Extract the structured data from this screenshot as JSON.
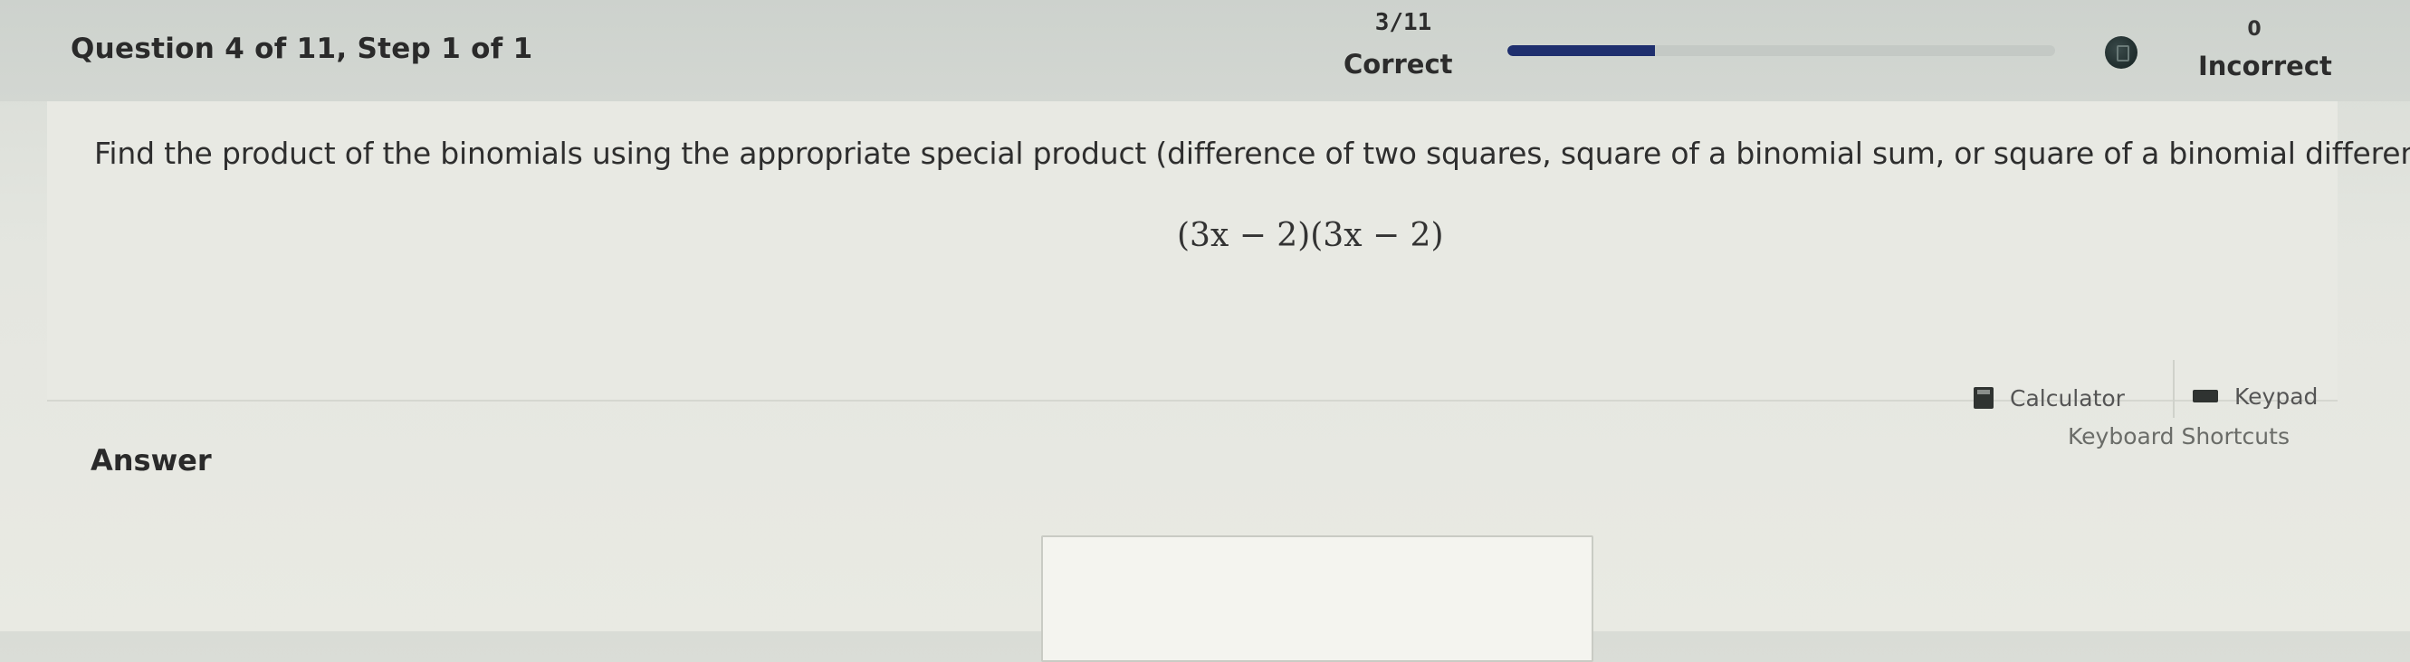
{
  "header": {
    "question_label": "Question 4 of 11,  Step 1 of 1",
    "correct_count": "3/11",
    "correct_label": "Correct",
    "incorrect_count": "0",
    "incorrect_label": "Incorrect",
    "progress_fraction": 0.27
  },
  "question": {
    "prompt": "Find the product of the binomials using the appropriate special product (difference of two squares, square of a binomial sum, or square of a binomial difference).",
    "expression": "(3x − 2)(3x − 2)"
  },
  "tools": {
    "calculator_label": "Calculator",
    "keypad_label": "Keypad",
    "shortcuts_label": "Keyboard Shortcuts"
  },
  "answer": {
    "label": "Answer",
    "value": ""
  },
  "icons": {
    "badge": "badge-icon",
    "calculator": "calculator-icon",
    "keypad": "keypad-icon"
  },
  "colors": {
    "progress_fill": "#1f2f6e",
    "progress_track": "#c4c9c5"
  }
}
